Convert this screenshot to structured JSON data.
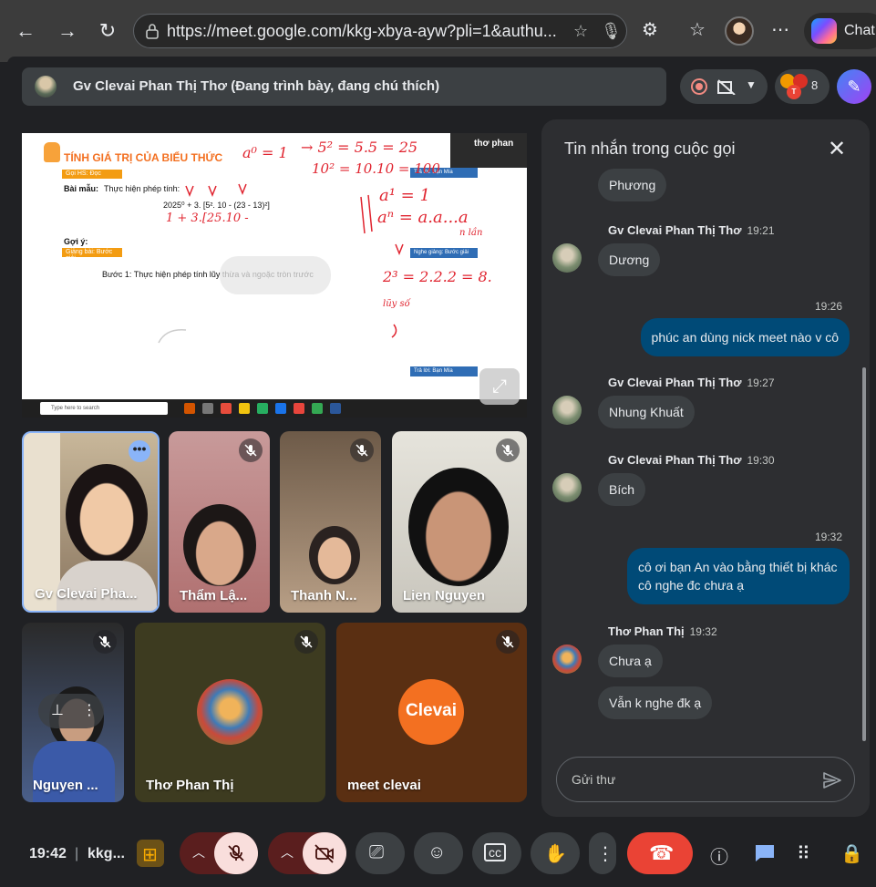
{
  "browser": {
    "url": "https://meet.google.com/kkg-xbya-ayw?pli=1&authu...",
    "copilot_label": "Chat",
    "back_icon": "arrow-left-icon",
    "forward_icon": "arrow-right-icon",
    "reload_icon": "reload-icon"
  },
  "meet": {
    "presenting_banner": "Gv Clevai Phan Thị Thơ (Đang trình bày, đang chú thích)",
    "participant_count": "8",
    "people_badge_initials": [
      "T"
    ],
    "accent_color": "#8ab4f8"
  },
  "presentation": {
    "slide_title": "TÍNH GIÁ TRỊ CỦA BIỂU THỨC",
    "tag_goi_hs": "Gọi HS: Đọc",
    "bai_mau_label": "Bài mẫu:",
    "bai_mau_text": "Thực hiện phép tính:",
    "expression": "2025⁰ + 3. [5². 10 - (23 - 13)²]",
    "goi_y_label": "Gợi ý:",
    "tag_giang_bai": "Giảng bài: Bước giải",
    "buoc_1": "Bước 1: Thực hiện phép tính lũy thừa và ngoặc tròn trước",
    "tag_tra_loi_1": "Trả lời: Bạn Mía",
    "tag_nghe_giang": "Nghe giảng: Bước giải",
    "tag_tra_loi_2": "Trả lời: Bạn Mía",
    "presenter_cam_name": "thơ phan",
    "taskbar_search": "Type here to search",
    "hw": {
      "l1": "a⁰ = 1",
      "l2": "→ 5² = 5.5 = 25",
      "l3": "10² = 10.10 = 100",
      "l4": "a¹ = 1",
      "l5": "aⁿ = a.a...a",
      "l5b": "n lần",
      "l6": "2³ = 2.2.2 = 8.",
      "l7": "lũy số",
      "l8": "1 + 3.[25.10 -"
    }
  },
  "tiles": [
    {
      "name": "Gv Clevai Pha...",
      "muted": false
    },
    {
      "name": "Thẩm Lậ...",
      "muted": true
    },
    {
      "name": "Thanh N...",
      "muted": true
    },
    {
      "name": "Lien Nguyen",
      "muted": true
    },
    {
      "name": "Nguyen ...",
      "muted": true
    },
    {
      "name": "Thơ Phan Thị",
      "muted": true
    },
    {
      "name": "meet clevai",
      "muted": true
    }
  ],
  "clevai_logo_text": "Clevai",
  "chat": {
    "title": "Tin nhắn trong cuộc gọi",
    "input_placeholder": "Gửi thư",
    "messages": {
      "m0": {
        "text": "Phương"
      },
      "m1": {
        "sender": "Gv Clevai Phan Thị Thơ",
        "time": "19:21",
        "text": "Dương"
      },
      "m2": {
        "time": "19:26",
        "text": "phúc an dùng nick meet nào v cô"
      },
      "m3": {
        "sender": "Gv Clevai Phan Thị Thơ",
        "time": "19:27",
        "text": "Nhung Khuất"
      },
      "m4": {
        "sender": "Gv Clevai Phan Thị Thơ",
        "time": "19:30",
        "text": "Bích"
      },
      "m5": {
        "time": "19:32",
        "text": "cô ơi bạn An vào bằng thiết bị khác cô nghe đc chưa ạ"
      },
      "m6": {
        "sender": "Thơ Phan Thị",
        "time": "19:32",
        "text1": "Chưa ạ",
        "text2": "Vẫn k nghe đk ạ"
      }
    }
  },
  "toolbar": {
    "time": "19:42",
    "separator": "|",
    "meeting_code": "kkg...",
    "leave_color": "#ea4335"
  }
}
